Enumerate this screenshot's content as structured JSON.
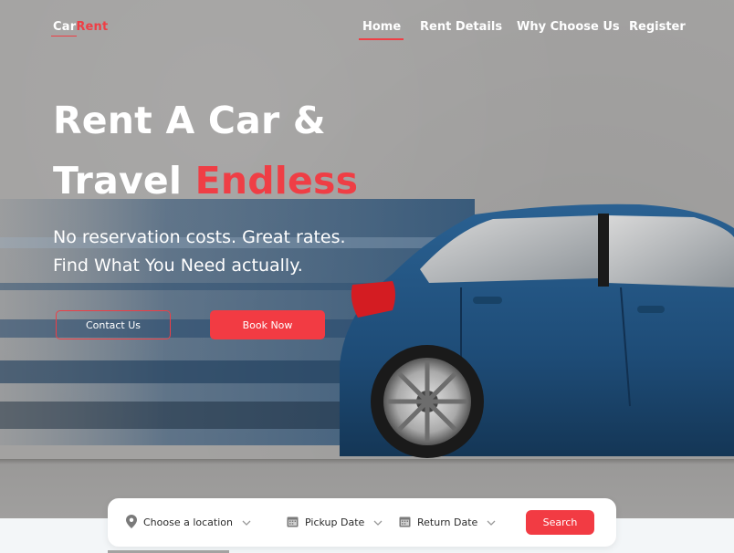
{
  "brand": {
    "logo_part1": "Car",
    "logo_part2": "Rent"
  },
  "nav": {
    "items": [
      "Home",
      "Rent Details",
      "Why Choose Us",
      "Register"
    ],
    "active": "Home"
  },
  "hero": {
    "headline_line1": "Rent A Car &",
    "headline_line2_prefix": "Travel",
    "headline_line2_accent": "Endless",
    "sub_line1": "No reservation costs. Great rates.",
    "sub_line2": "Find What You Need actually.",
    "contact_label": "Contact Us",
    "book_label": "Book Now"
  },
  "search": {
    "location_label": "Choose a location",
    "pickup_label": "Pickup Date",
    "return_label": "Return Date",
    "button_label": "Search",
    "icons": [
      "location-pin-icon",
      "calendar-icon",
      "calendar-icon",
      "chevron-down-icon"
    ]
  },
  "colors": {
    "accent": "#ef3e45",
    "hero_background": "#a3a2a1",
    "car_body": "#1f4f7a",
    "white": "#ffffff"
  }
}
